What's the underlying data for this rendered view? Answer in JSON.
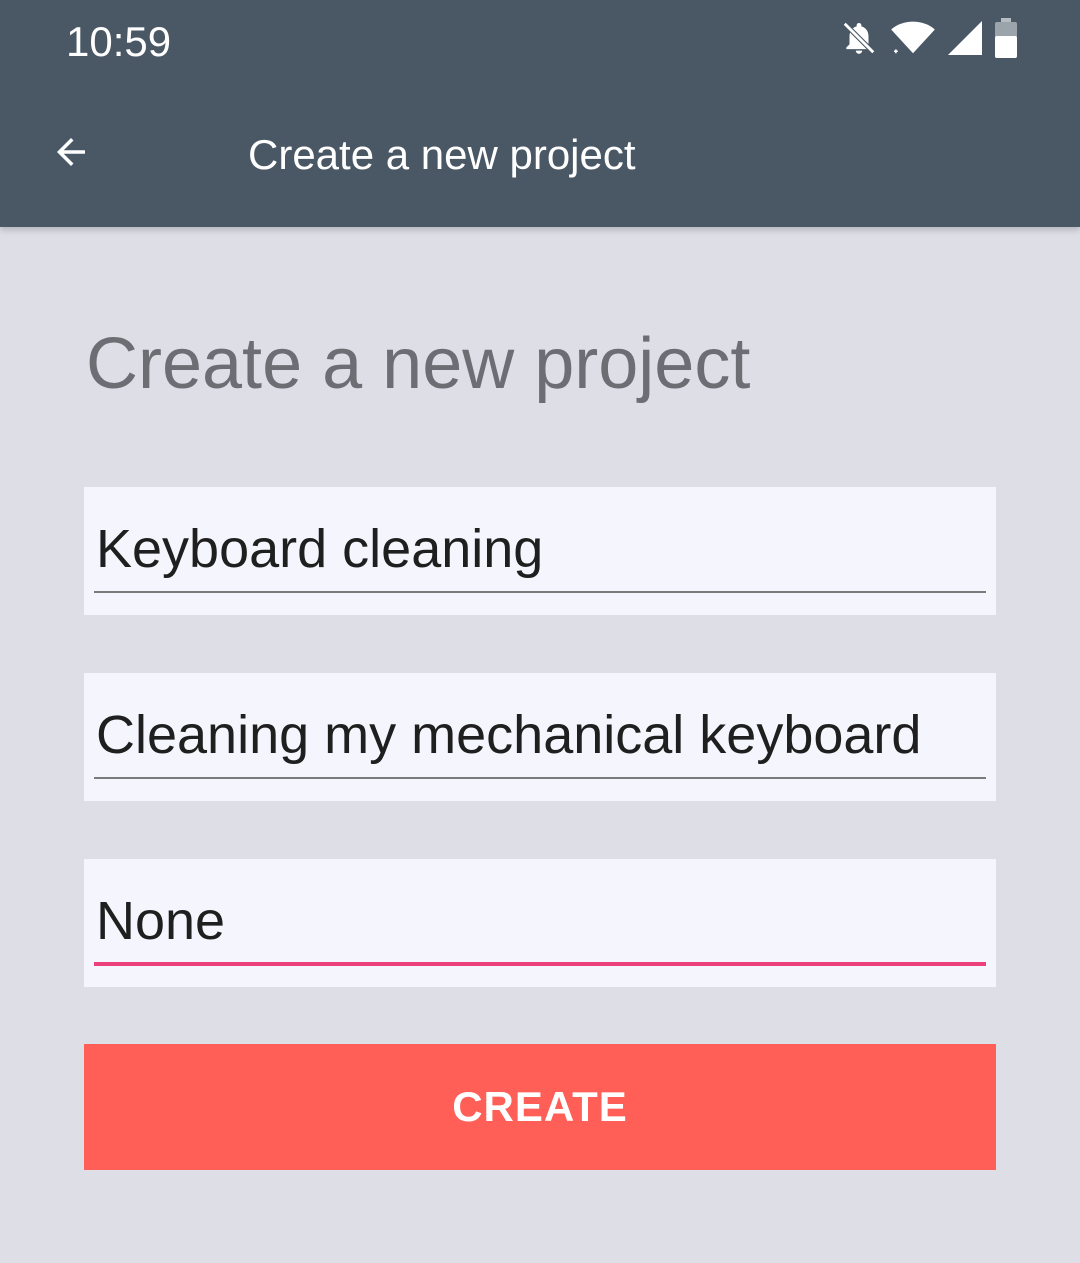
{
  "status_bar": {
    "time": "10:59",
    "icons": [
      "notifications-off-icon",
      "wifi-icon",
      "cell-signal-icon",
      "battery-icon"
    ]
  },
  "toolbar": {
    "back_icon": "arrow-left-icon",
    "title": "Create a new project"
  },
  "form": {
    "heading": "Create a new project",
    "fields": [
      {
        "value": "Keyboard cleaning",
        "focused": false
      },
      {
        "value": "Cleaning my mechanical keyboard",
        "focused": false
      },
      {
        "value": "None",
        "focused": true
      }
    ],
    "create_label": "CREATE"
  },
  "colors": {
    "toolbar_bg": "#4a5866",
    "page_bg": "#dddee6",
    "field_bg": "#f5f6fd",
    "focus_underline": "#ec407a",
    "button_bg": "#ff5f57"
  }
}
